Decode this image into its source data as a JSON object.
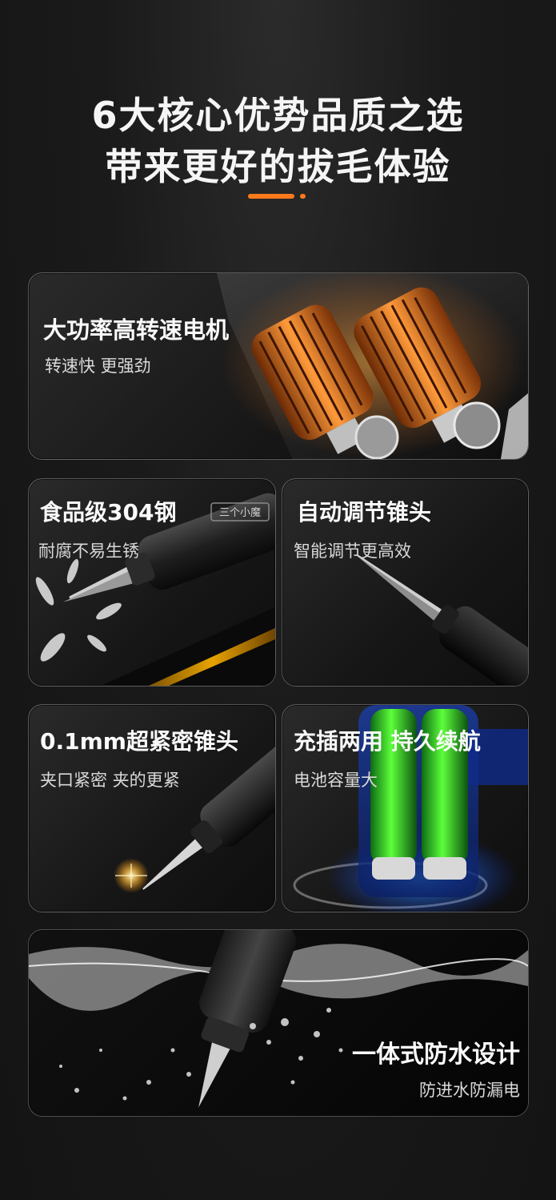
{
  "header": {
    "title_line1": "6大核心优势品质之选",
    "title_line2": "带来更好的拔毛体验",
    "accent_color": "#ff7a1a"
  },
  "features": [
    {
      "title": "大功率高转速电机",
      "subtitle": "转速快 更强劲"
    },
    {
      "title": "食品级304钢",
      "subtitle": "耐腐不易生锈",
      "product_logo": "三个小魔"
    },
    {
      "title": "自动调节锥头",
      "subtitle": "智能调节更高效"
    },
    {
      "title": "0.1mm超紧密锥头",
      "subtitle": "夹口紧密 夹的更紧"
    },
    {
      "title": "充插两用 持久续航",
      "subtitle": "电池容量大"
    },
    {
      "title": "一体式防水设计",
      "subtitle": "防进水防漏电"
    }
  ]
}
